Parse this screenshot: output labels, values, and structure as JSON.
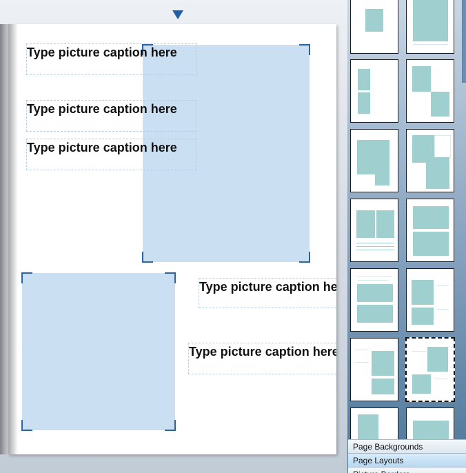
{
  "page": {
    "captions": [
      {
        "text": "Type picture caption here"
      },
      {
        "text": "Type picture caption here"
      },
      {
        "text": "Type picture caption here"
      },
      {
        "text": "Type picture caption here"
      },
      {
        "text": "Type picture caption here"
      }
    ]
  },
  "panel": {
    "tabs": [
      {
        "label": "Page Backgrounds",
        "active": false
      },
      {
        "label": "Page Layouts",
        "active": true
      },
      {
        "label": "Picture Borders",
        "active": false
      }
    ]
  },
  "colors": {
    "photo_placeholder": "#cbdff3",
    "corner_handle": "#2b63a8",
    "layout_tile": "#9fcfcf",
    "page_marker": "#1f5fa5"
  }
}
